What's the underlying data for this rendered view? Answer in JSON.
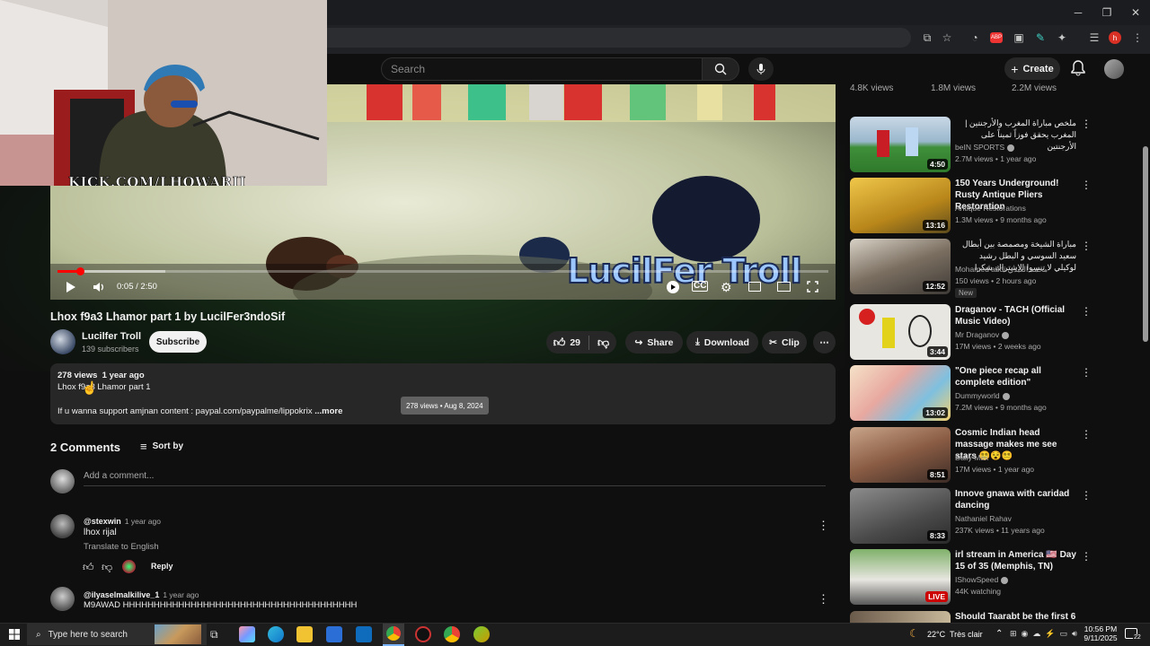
{
  "youtube": {
    "search_placeholder": "Search",
    "create_label": "Create"
  },
  "video": {
    "overlay_text": "LucilFer Troll",
    "webcam_caption": "KICK.COM/LHOWARII",
    "time_display": "0:05 / 2:50",
    "progress_fraction": 0.0294,
    "title": "Lhox f9a3 Lhamor part 1 by LucilFer3ndoSif"
  },
  "channel": {
    "name": "Lucilfer Troll",
    "subscribers": "139 subscribers",
    "subscribe_label": "Subscribe"
  },
  "actions": {
    "likes": "29",
    "share": "Share",
    "download": "Download",
    "clip": "Clip"
  },
  "description": {
    "views_date": "278 views  1 year ago",
    "line1": "Lhox f9a3 Lhamor part 1",
    "line2": "If u wanna support amjnan content : paypal.com/paypalme/lippokrix",
    "more": "...more",
    "tooltip": "278 views • Aug 8, 2024"
  },
  "comments": {
    "count_label": "2 Comments",
    "sort_label": "Sort by",
    "add_placeholder": "Add a comment...",
    "items": [
      {
        "handle": "@stexwin",
        "time": "1 year ago",
        "text": "lhox rijal",
        "translate": "Translate to English",
        "reply": "Reply"
      },
      {
        "handle": "@ilyaselmalkilive_1",
        "time": "1 year ago",
        "text": "M9AWAD HHHHHHHHHHHHHHHHHHHHHHHHHHHHHHHHHHHHHH"
      }
    ]
  },
  "sidebar": {
    "top_views": [
      "4.8K views",
      "1.8M views",
      "2.2M views"
    ],
    "items": [
      {
        "title": "ملخص مباراة المغرب والأرجنتين | المغرب يحقق فوزاً ثميناً على الأرجنتين",
        "channel": "beIN SPORTS",
        "meta": "2.7M views • 1 year ago",
        "duration": "4:50",
        "verified": true
      },
      {
        "title": "150 Years Underground! Rusty Antique Pliers Restoration",
        "channel": "Antique Restorations",
        "meta": "1.3M views • 9 months ago",
        "duration": "13:16"
      },
      {
        "title": "مباراة الشيخة ومصمصة بين أبطال سعيد السوسي و البطل رشيد لوكيلي لا تنسوا الاشتراك شكرا",
        "channel": "Mohamed abdi محمد العبدي",
        "meta": "150 views • 2 hours ago",
        "badge": "New",
        "duration": "12:52"
      },
      {
        "title": "Draganov - TACH (Official Music Video)",
        "channel": "Mr Draganov",
        "meta": "17M views • 2 weeks ago",
        "duration": "3:44",
        "verified": true
      },
      {
        "title": "\"One piece recap all complete edition\"",
        "channel": "Dummyworld",
        "meta": "7.2M views • 9 months ago",
        "duration": "13:02",
        "verified": true
      },
      {
        "title": "Cosmic Indian head massage makes me see stars 😵‍💫😵😵‍💫",
        "channel": "Daily Max",
        "meta": "17M views • 1 year ago",
        "duration": "8:51"
      },
      {
        "title": "Innove gnawa with caridad dancing",
        "channel": "Nathaniel Rahav",
        "meta": "237K views • 11 years ago",
        "duration": "8:33"
      },
      {
        "title": "irl stream in America 🇺🇸 Day 15 of 35 (Memphis, TN)",
        "channel": "IShowSpeed",
        "meta": "44K watching",
        "duration": "LIVE",
        "verified": true
      },
      {
        "title": "Should Taarabt be the first 6",
        "channel": "",
        "meta": "",
        "duration": ""
      }
    ]
  },
  "taskbar": {
    "search_placeholder": "Type here to search",
    "weather": "22°C  Très clair",
    "time": "10:56 PM",
    "date": "9/11/2025",
    "notif_count": "22"
  }
}
